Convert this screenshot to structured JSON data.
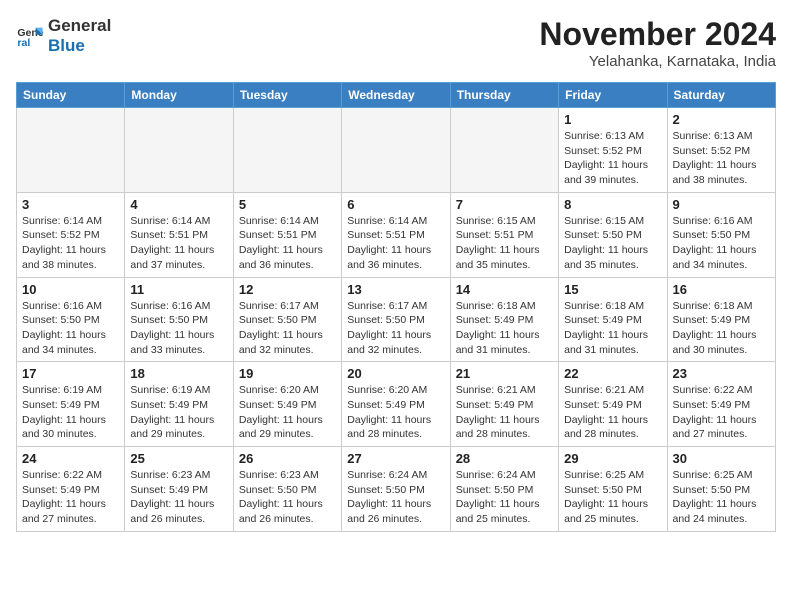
{
  "logo": {
    "line1": "General",
    "line2": "Blue"
  },
  "title": "November 2024",
  "location": "Yelahanka, Karnataka, India",
  "weekdays": [
    "Sunday",
    "Monday",
    "Tuesday",
    "Wednesday",
    "Thursday",
    "Friday",
    "Saturday"
  ],
  "weeks": [
    [
      {
        "day": "",
        "info": "",
        "empty": true
      },
      {
        "day": "",
        "info": "",
        "empty": true
      },
      {
        "day": "",
        "info": "",
        "empty": true
      },
      {
        "day": "",
        "info": "",
        "empty": true
      },
      {
        "day": "",
        "info": "",
        "empty": true
      },
      {
        "day": "1",
        "info": "Sunrise: 6:13 AM\nSunset: 5:52 PM\nDaylight: 11 hours and 39 minutes.",
        "empty": false
      },
      {
        "day": "2",
        "info": "Sunrise: 6:13 AM\nSunset: 5:52 PM\nDaylight: 11 hours and 38 minutes.",
        "empty": false
      }
    ],
    [
      {
        "day": "3",
        "info": "Sunrise: 6:14 AM\nSunset: 5:52 PM\nDaylight: 11 hours and 38 minutes.",
        "empty": false
      },
      {
        "day": "4",
        "info": "Sunrise: 6:14 AM\nSunset: 5:51 PM\nDaylight: 11 hours and 37 minutes.",
        "empty": false
      },
      {
        "day": "5",
        "info": "Sunrise: 6:14 AM\nSunset: 5:51 PM\nDaylight: 11 hours and 36 minutes.",
        "empty": false
      },
      {
        "day": "6",
        "info": "Sunrise: 6:14 AM\nSunset: 5:51 PM\nDaylight: 11 hours and 36 minutes.",
        "empty": false
      },
      {
        "day": "7",
        "info": "Sunrise: 6:15 AM\nSunset: 5:51 PM\nDaylight: 11 hours and 35 minutes.",
        "empty": false
      },
      {
        "day": "8",
        "info": "Sunrise: 6:15 AM\nSunset: 5:50 PM\nDaylight: 11 hours and 35 minutes.",
        "empty": false
      },
      {
        "day": "9",
        "info": "Sunrise: 6:16 AM\nSunset: 5:50 PM\nDaylight: 11 hours and 34 minutes.",
        "empty": false
      }
    ],
    [
      {
        "day": "10",
        "info": "Sunrise: 6:16 AM\nSunset: 5:50 PM\nDaylight: 11 hours and 34 minutes.",
        "empty": false
      },
      {
        "day": "11",
        "info": "Sunrise: 6:16 AM\nSunset: 5:50 PM\nDaylight: 11 hours and 33 minutes.",
        "empty": false
      },
      {
        "day": "12",
        "info": "Sunrise: 6:17 AM\nSunset: 5:50 PM\nDaylight: 11 hours and 32 minutes.",
        "empty": false
      },
      {
        "day": "13",
        "info": "Sunrise: 6:17 AM\nSunset: 5:50 PM\nDaylight: 11 hours and 32 minutes.",
        "empty": false
      },
      {
        "day": "14",
        "info": "Sunrise: 6:18 AM\nSunset: 5:49 PM\nDaylight: 11 hours and 31 minutes.",
        "empty": false
      },
      {
        "day": "15",
        "info": "Sunrise: 6:18 AM\nSunset: 5:49 PM\nDaylight: 11 hours and 31 minutes.",
        "empty": false
      },
      {
        "day": "16",
        "info": "Sunrise: 6:18 AM\nSunset: 5:49 PM\nDaylight: 11 hours and 30 minutes.",
        "empty": false
      }
    ],
    [
      {
        "day": "17",
        "info": "Sunrise: 6:19 AM\nSunset: 5:49 PM\nDaylight: 11 hours and 30 minutes.",
        "empty": false
      },
      {
        "day": "18",
        "info": "Sunrise: 6:19 AM\nSunset: 5:49 PM\nDaylight: 11 hours and 29 minutes.",
        "empty": false
      },
      {
        "day": "19",
        "info": "Sunrise: 6:20 AM\nSunset: 5:49 PM\nDaylight: 11 hours and 29 minutes.",
        "empty": false
      },
      {
        "day": "20",
        "info": "Sunrise: 6:20 AM\nSunset: 5:49 PM\nDaylight: 11 hours and 28 minutes.",
        "empty": false
      },
      {
        "day": "21",
        "info": "Sunrise: 6:21 AM\nSunset: 5:49 PM\nDaylight: 11 hours and 28 minutes.",
        "empty": false
      },
      {
        "day": "22",
        "info": "Sunrise: 6:21 AM\nSunset: 5:49 PM\nDaylight: 11 hours and 28 minutes.",
        "empty": false
      },
      {
        "day": "23",
        "info": "Sunrise: 6:22 AM\nSunset: 5:49 PM\nDaylight: 11 hours and 27 minutes.",
        "empty": false
      }
    ],
    [
      {
        "day": "24",
        "info": "Sunrise: 6:22 AM\nSunset: 5:49 PM\nDaylight: 11 hours and 27 minutes.",
        "empty": false
      },
      {
        "day": "25",
        "info": "Sunrise: 6:23 AM\nSunset: 5:49 PM\nDaylight: 11 hours and 26 minutes.",
        "empty": false
      },
      {
        "day": "26",
        "info": "Sunrise: 6:23 AM\nSunset: 5:50 PM\nDaylight: 11 hours and 26 minutes.",
        "empty": false
      },
      {
        "day": "27",
        "info": "Sunrise: 6:24 AM\nSunset: 5:50 PM\nDaylight: 11 hours and 26 minutes.",
        "empty": false
      },
      {
        "day": "28",
        "info": "Sunrise: 6:24 AM\nSunset: 5:50 PM\nDaylight: 11 hours and 25 minutes.",
        "empty": false
      },
      {
        "day": "29",
        "info": "Sunrise: 6:25 AM\nSunset: 5:50 PM\nDaylight: 11 hours and 25 minutes.",
        "empty": false
      },
      {
        "day": "30",
        "info": "Sunrise: 6:25 AM\nSunset: 5:50 PM\nDaylight: 11 hours and 24 minutes.",
        "empty": false
      }
    ]
  ]
}
